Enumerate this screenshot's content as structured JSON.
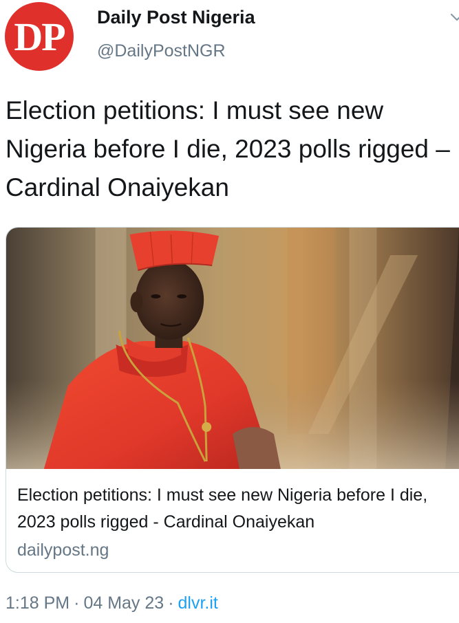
{
  "author": {
    "avatar_text": "DP",
    "display_name": "Daily Post Nigeria",
    "handle": "@DailyPostNGR",
    "avatar_color": "#e0302b"
  },
  "tweet": {
    "text": "Election petitions: I must see new Nigeria before I die, 2023 polls rigged – Cardinal Onaiyekan"
  },
  "card": {
    "image_icon": "news-photo-cardinal",
    "title": "Election petitions: I must see new Nigeria before I die, 2023 polls rigged - Cardinal Onaiyekan",
    "domain": "dailypost.ng"
  },
  "meta": {
    "time": "1:18 PM",
    "separator": "·",
    "date": "04 May 23",
    "source": "dlvr.it",
    "link_color": "#1da1f2"
  }
}
